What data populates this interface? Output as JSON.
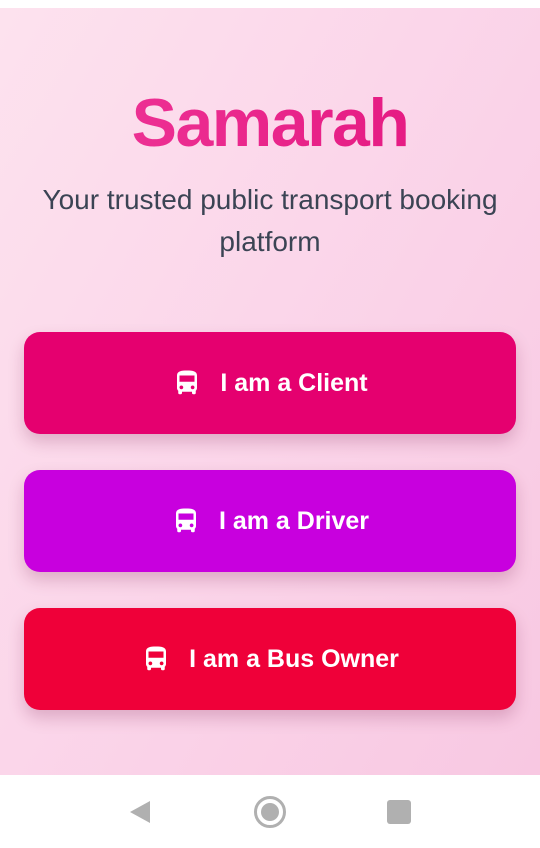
{
  "app": {
    "name": "Samarah",
    "tagline": "Your trusted public transport booking platform"
  },
  "roles": [
    {
      "label": "I am a Client",
      "icon": "bus-icon",
      "color": "#e5006f"
    },
    {
      "label": "I am a Driver",
      "icon": "bus-icon",
      "color": "#c800de"
    },
    {
      "label": "I am a Bus Owner",
      "icon": "bus-icon",
      "color": "#ef0039"
    }
  ],
  "nav_bar": {
    "back": "back-icon",
    "home": "home-icon",
    "recents": "recents-icon"
  },
  "colors": {
    "brand": "#e7218a",
    "tagline": "#3b4454",
    "background": "#fbd6ea"
  }
}
